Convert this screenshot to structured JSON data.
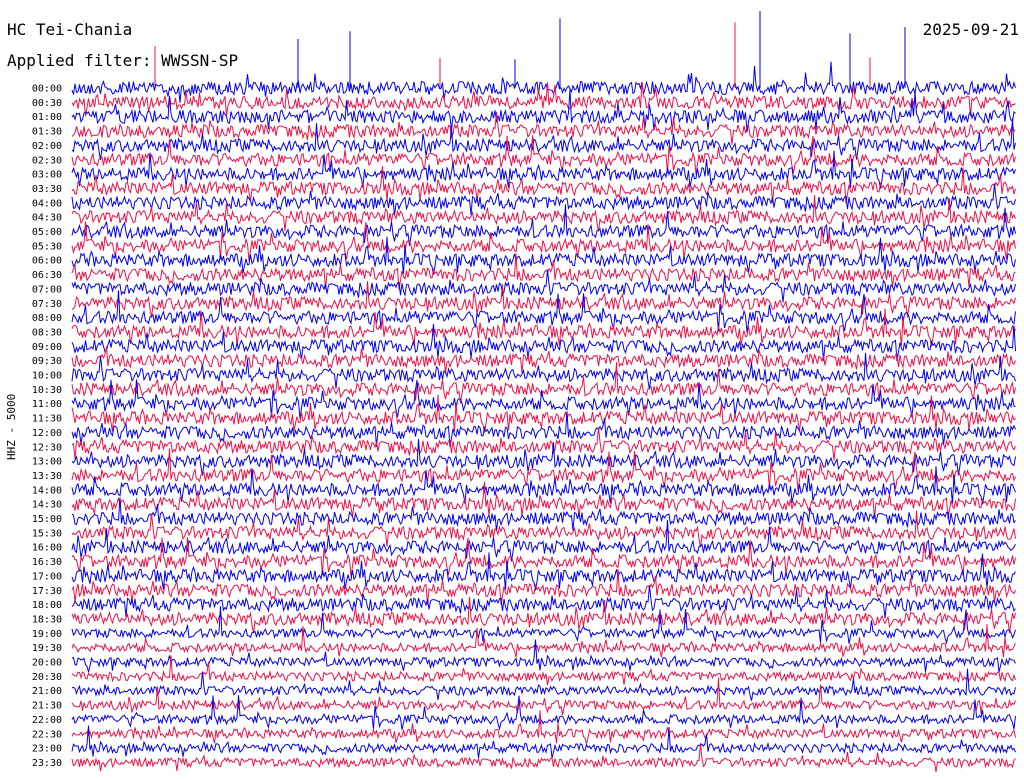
{
  "header": {
    "station": "HC Tei-Chania",
    "date": "2025-09-21",
    "filter": "Applied filter: WWSSN-SP"
  },
  "chart_data": {
    "type": "line",
    "title": "HC Tei-Chania",
    "subtitle": "Applied filter: WWSSN-SP",
    "date": "2025-09-21",
    "ylabel": "HHZ - 5000",
    "xlabel": "",
    "row_labels": [
      "00:00",
      "00:30",
      "01:00",
      "01:30",
      "02:00",
      "02:30",
      "03:00",
      "03:30",
      "04:00",
      "04:30",
      "05:00",
      "05:30",
      "06:00",
      "06:30",
      "07:00",
      "07:30",
      "08:00",
      "08:30",
      "09:00",
      "09:30",
      "10:00",
      "10:30",
      "11:00",
      "11:30",
      "12:00",
      "12:30",
      "13:00",
      "13:30",
      "14:00",
      "14:30",
      "15:00",
      "15:30",
      "16:00",
      "16:30",
      "17:00",
      "17:30",
      "18:00",
      "18:30",
      "19:00",
      "19:30",
      "20:00",
      "20:30",
      "21:00",
      "21:30",
      "22:00",
      "22:30",
      "23:00",
      "23:30"
    ],
    "trace_colors": [
      "#0000ee",
      "#ee1144"
    ],
    "row_minutes": 30,
    "grid": false,
    "legend": "none"
  }
}
